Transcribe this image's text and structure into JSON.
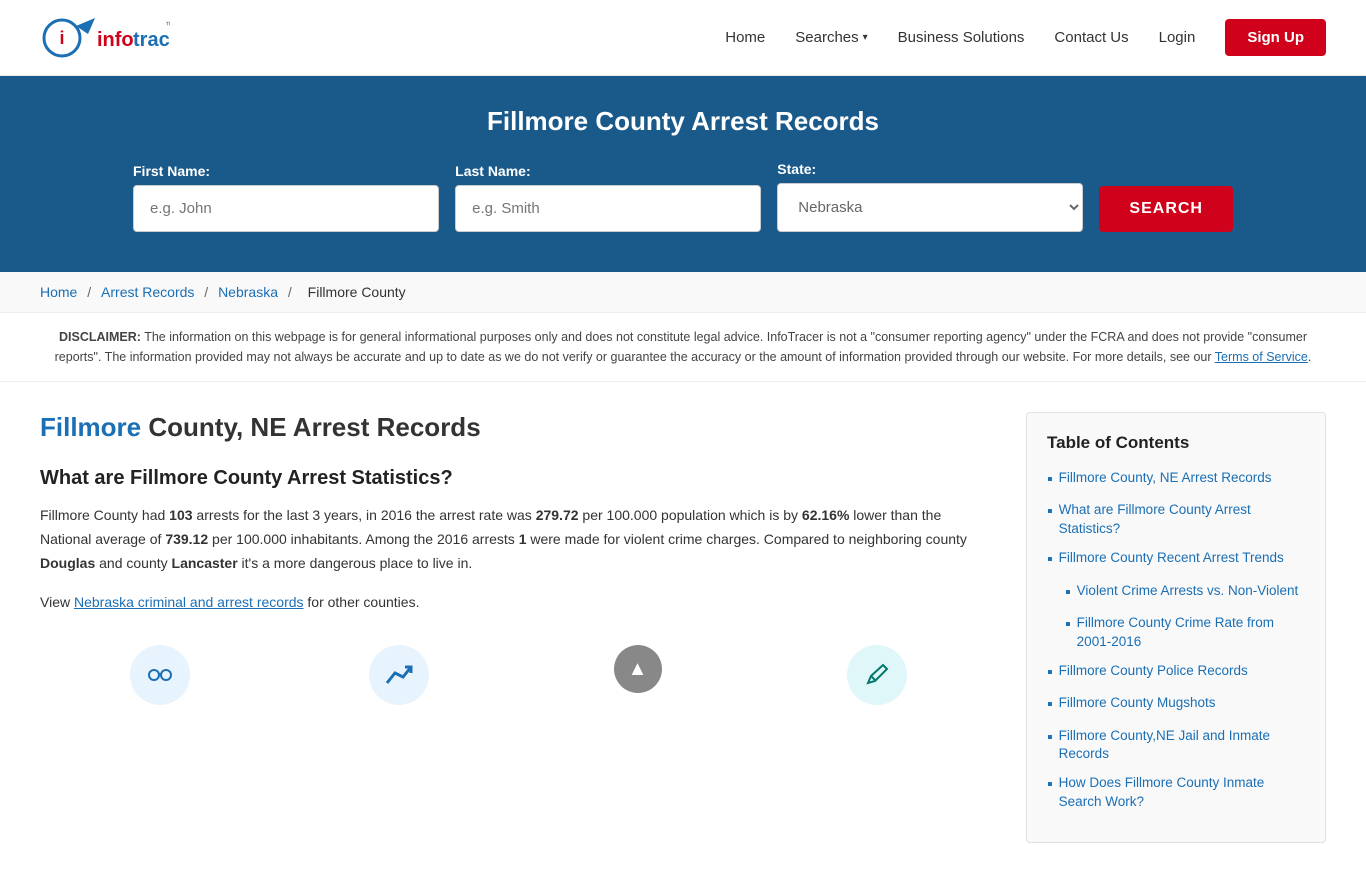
{
  "header": {
    "logo_info": "info",
    "logo_tracer": "tracer",
    "logo_tm": "™",
    "nav": {
      "home": "Home",
      "searches": "Searches",
      "business_solutions": "Business Solutions",
      "contact_us": "Contact Us",
      "login": "Login",
      "signup": "Sign Up"
    }
  },
  "hero": {
    "title": "Fillmore County Arrest Records",
    "form": {
      "first_name_label": "First Name:",
      "first_name_placeholder": "e.g. John",
      "last_name_label": "Last Name:",
      "last_name_placeholder": "e.g. Smith",
      "state_label": "State:",
      "state_value": "Nebraska",
      "search_button": "SEARCH"
    }
  },
  "breadcrumb": {
    "home": "Home",
    "arrest_records": "Arrest Records",
    "nebraska": "Nebraska",
    "current": "Fillmore County"
  },
  "disclaimer": {
    "label": "DISCLAIMER:",
    "text": "The information on this webpage is for general informational purposes only and does not constitute legal advice. InfoTracer is not a \"consumer reporting agency\" under the FCRA and does not provide \"consumer reports\". The information provided may not always be accurate and up to date as we do not verify or guarantee the accuracy or the amount of information provided through our website. For more details, see our",
    "link_text": "Terms of Service",
    "period": "."
  },
  "main": {
    "title_highlight": "Fillmore",
    "title_rest": " County, NE Arrest Records",
    "section1_heading": "What are Fillmore County Arrest Statistics?",
    "section1_p1_before": "Fillmore County had ",
    "section1_arrests": "103",
    "section1_p1_mid1": " arrests for the last 3 years, in 2016 the arrest rate was ",
    "section1_rate": "279.72",
    "section1_p1_mid2": " per 100.000 population which is by ",
    "section1_pct": "62.16%",
    "section1_p1_mid3": " lower than the National average of ",
    "section1_national": "739.12",
    "section1_p1_mid4": " per 100.000 inhabitants. Among the 2016 arrests ",
    "section1_violent": "1",
    "section1_p1_mid5": " were made for violent crime charges. Compared to neighboring county ",
    "section1_county1": "Douglas",
    "section1_p1_mid6": " and county ",
    "section1_county2": "Lancaster",
    "section1_p1_end": " it's a more dangerous place to live in.",
    "section1_p2_before": "View ",
    "section1_link": "Nebraska criminal and arrest records",
    "section1_p2_after": " for other counties."
  },
  "toc": {
    "heading": "Table of Contents",
    "items": [
      {
        "text": "Fillmore County, NE Arrest Records",
        "sub": false
      },
      {
        "text": "What are Fillmore County Arrest Statistics?",
        "sub": false
      },
      {
        "text": "Fillmore County Recent Arrest Trends",
        "sub": false
      },
      {
        "text": "Violent Crime Arrests vs. Non-Violent",
        "sub": true
      },
      {
        "text": "Fillmore County Crime Rate from 2001-2016",
        "sub": true
      },
      {
        "text": "Fillmore County Police Records",
        "sub": false
      },
      {
        "text": "Fillmore County Mugshots",
        "sub": false
      },
      {
        "text": "Fillmore County,NE Jail and Inmate Records",
        "sub": false
      },
      {
        "text": "How Does Fillmore County Inmate Search Work?",
        "sub": false
      }
    ]
  }
}
